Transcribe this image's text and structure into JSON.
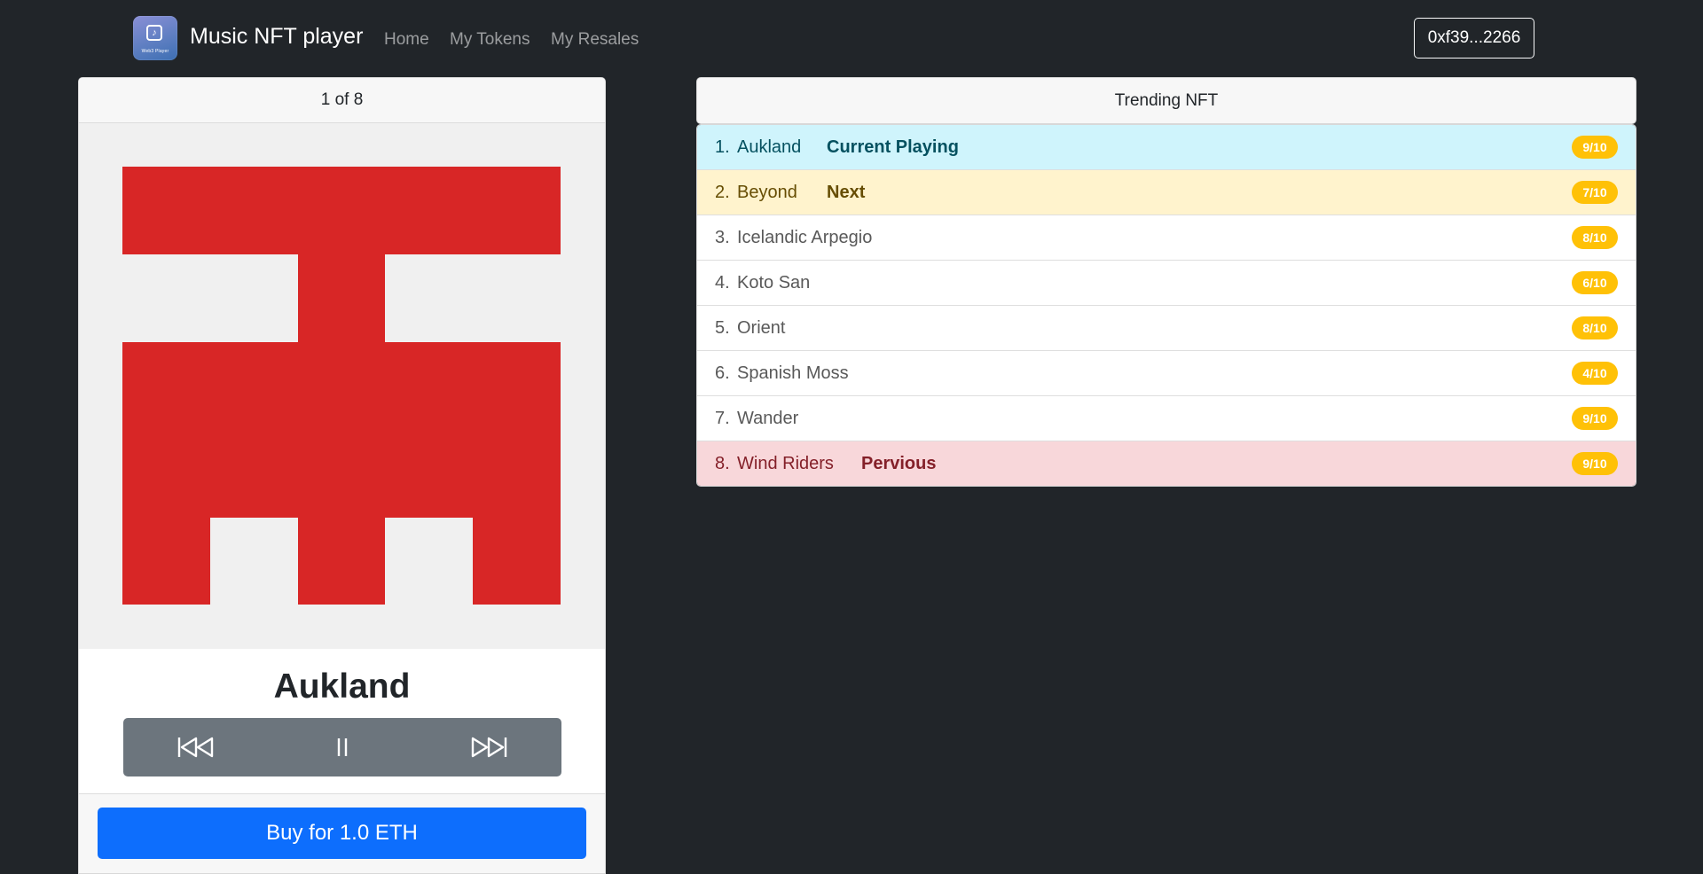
{
  "navbar": {
    "brand_title": "Music NFT player",
    "logo_text": "Web3 Player",
    "links": [
      "Home",
      "My Tokens",
      "My Resales"
    ],
    "account": "0xf39...2266"
  },
  "player": {
    "counter": "1 of 8",
    "title": "Aukland",
    "buy_label": "Buy for 1.0 ETH",
    "art_colors": {
      "background": "#f0f0f0",
      "foreground": "#d82626"
    },
    "controls": [
      "skip-backward-icon",
      "pause-icon",
      "skip-forward-icon"
    ]
  },
  "trending": {
    "header": "Trending NFT",
    "items": [
      {
        "num": "1.",
        "name": "Aukland",
        "status": "Current Playing",
        "rating": "9/10",
        "variant": "info"
      },
      {
        "num": "2.",
        "name": "Beyond",
        "status": "Next",
        "rating": "7/10",
        "variant": "warning"
      },
      {
        "num": "3.",
        "name": "Icelandic Arpegio",
        "status": "",
        "rating": "8/10",
        "variant": ""
      },
      {
        "num": "4.",
        "name": "Koto San",
        "status": "",
        "rating": "6/10",
        "variant": ""
      },
      {
        "num": "5.",
        "name": "Orient",
        "status": "",
        "rating": "8/10",
        "variant": ""
      },
      {
        "num": "6.",
        "name": "Spanish Moss",
        "status": "",
        "rating": "4/10",
        "variant": ""
      },
      {
        "num": "7.",
        "name": "Wander",
        "status": "",
        "rating": "9/10",
        "variant": ""
      },
      {
        "num": "8.",
        "name": "Wind Riders",
        "status": "Pervious",
        "rating": "9/10",
        "variant": "danger"
      }
    ]
  },
  "colors": {
    "page_bg": "#212529",
    "primary": "#0d6efd",
    "secondary": "#6c757d",
    "badge": "#ffc107"
  }
}
